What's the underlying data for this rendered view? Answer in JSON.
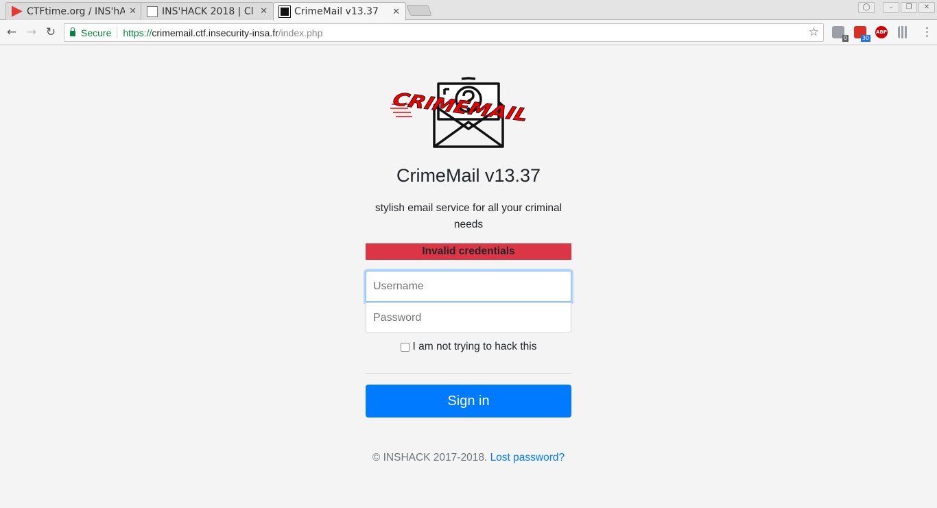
{
  "browser": {
    "tabs": [
      {
        "title": "CTFtime.org / INS'hA",
        "icon": "ctftime-flag-icon"
      },
      {
        "title": "INS'HACK 2018 | Cl",
        "icon": "document-icon"
      },
      {
        "title": "CrimeMail v13.37",
        "icon": "crimemail-favicon-icon"
      }
    ],
    "tab_close": "✕",
    "omnibox": {
      "secure_label": "Secure",
      "url_scheme": "https://",
      "url_host": "crimemail.ctf.insecurity-insa.fr",
      "url_path": "/index.php"
    },
    "extensions": [
      {
        "name": "extension-1-icon",
        "badge": "0",
        "badge_color": "#5f6368"
      },
      {
        "name": "extension-2-icon",
        "badge": "30",
        "badge_color": "#1a73e8"
      },
      {
        "name": "adblock-plus-icon",
        "label": "ABP"
      }
    ],
    "colors": {
      "secure": "#0b8043"
    }
  },
  "page": {
    "logo_text": "CRIMEMAIL",
    "title": "CrimeMail v13.37",
    "tagline": "stylish email service for all your criminal needs",
    "alert": "Invalid credentials",
    "username_placeholder": "Username",
    "password_placeholder": "Password",
    "checkbox_label": "I am not trying to hack this",
    "signin_label": "Sign in",
    "footer_text": "© INSHACK 2017-2018.",
    "footer_link": "Lost password?",
    "colors": {
      "primary": "#007bff",
      "danger": "#dc3545"
    }
  }
}
